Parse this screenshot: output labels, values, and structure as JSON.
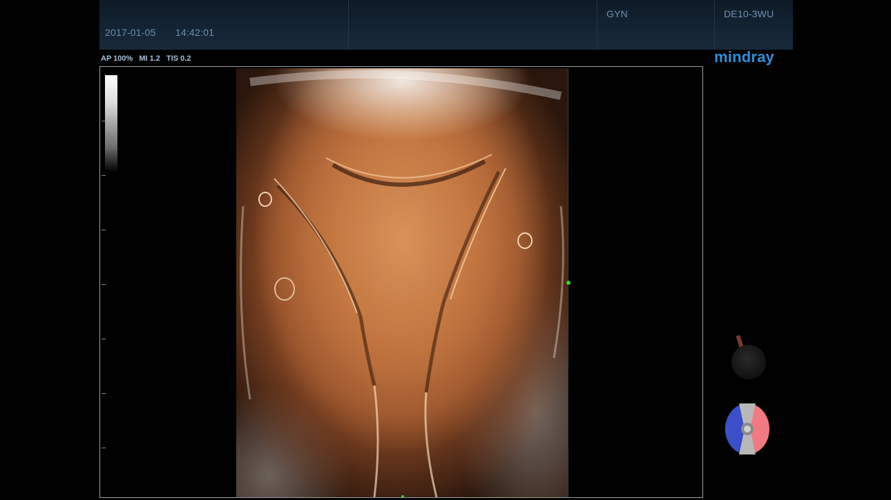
{
  "header": {
    "date": "2017-01-05",
    "time": "14:42:01",
    "exam_mode": "GYN",
    "probe": "DE10-3WU"
  },
  "acoustic": {
    "ap": "AP 100%",
    "mi": "MI 1.2",
    "tis": "TIS 0.2"
  },
  "brand": {
    "logo": "mindray"
  },
  "colors": {
    "header_text": "#6f8fb0",
    "logo": "#2f8fd8",
    "cursor": "#28e028",
    "orientation_left": "#3a4fc8",
    "orientation_right": "#f07a80"
  },
  "icons": {
    "render_knob": "dial-knob-icon",
    "orientation": "orientation-disc-icon"
  }
}
